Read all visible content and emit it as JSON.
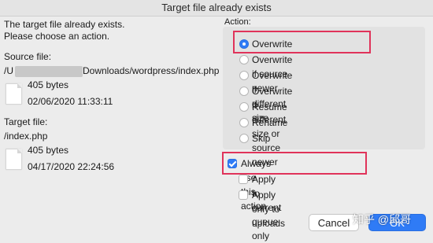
{
  "window": {
    "title": "Target file already exists"
  },
  "message": {
    "line1": "The target file already exists.",
    "line2": "Please choose an action."
  },
  "source": {
    "heading": "Source file:",
    "path_prefix": "/U",
    "path_suffix": "Downloads/wordpress/index.php",
    "size": "405 bytes",
    "date": "02/06/2020 11:33:11"
  },
  "target": {
    "heading": "Target file:",
    "path": "/index.php",
    "size": "405 bytes",
    "date": "04/17/2020 22:24:56"
  },
  "action": {
    "heading": "Action:",
    "options": [
      "Overwrite",
      "Overwrite if source newer",
      "Overwrite if different size",
      "Overwrite if different size or source newer",
      "Resume",
      "Rename",
      "Skip"
    ],
    "selected_index": 0
  },
  "checkboxes": [
    {
      "label": "Always use this action",
      "checked": true
    },
    {
      "label": "Apply to current queue only",
      "checked": false
    },
    {
      "label": "Apply only to uploads",
      "checked": false
    }
  ],
  "buttons": {
    "cancel": "Cancel",
    "ok": "OK"
  },
  "watermark": "知乎 @邱哥",
  "colors": {
    "accent": "#2f7bf6",
    "highlight": "#e0335a"
  },
  "icons": [
    "file-icon"
  ]
}
